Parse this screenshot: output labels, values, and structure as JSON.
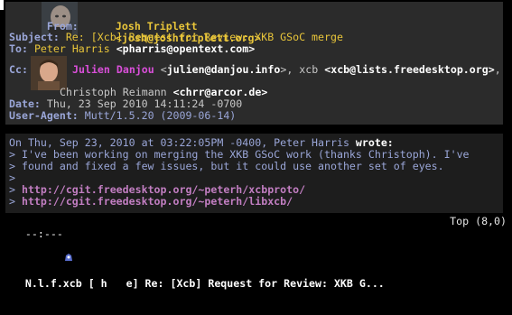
{
  "headers": {
    "from_label": "From:",
    "from_name": "Josh Triplett",
    "from_email": "<josh@joshtriplett.org>",
    "subject_label": "Subject:",
    "subject": "Re: [Xcb] Request for Review: XKB GSoC merge",
    "to_label": "To:",
    "to_name": "Peter Harris",
    "to_email": "<pharris@opentext.com>",
    "cc_label": "Cc:",
    "cc_name1": "Julien Danjou",
    "cc_email1_prefix": "<",
    "cc_email1": "julien@danjou.info",
    "cc_email1_suffix": ">, xcb ",
    "cc_email2": "<xcb@lists.freedesktop.org>",
    "cc_sep": ",",
    "cc_name2": "Christoph Reimann",
    "cc_email3": "<chrr@arcor.de>",
    "date_label": "Date:",
    "date": "Thu, 23 Sep 2010 14:11:24 -0700",
    "ua_label": "User-Agent:",
    "user_agent": "Mutt/1.5.20 (2009-06-14)"
  },
  "body": {
    "attribution": "On Thu, Sep 23, 2010 at 03:22:05PM -0400, Peter Harris",
    "wrote": "wrote:",
    "quote_lines": [
      "> I've been working on merging the XKB GSoC work (thanks Christoph). I've",
      "> found and fixed a few issues, but it could use another set of eyes.",
      ">"
    ],
    "quote_gt": ">",
    "url1": "http://cgit.freedesktop.org/~peterh/xcbproto/",
    "url2": "http://cgit.freedesktop.org/~peterh/libxcb/"
  },
  "status": {
    "mode": "--:---",
    "buffer": "N.l.f.xcb [ h   e] Re: [Xcb] Request for Review: XKB G...",
    "position": "Top (8,0)"
  },
  "colors": {
    "label": "#9aa6d8",
    "from": "#e8c53a",
    "cc_name": "#d94fd9",
    "url": "#c27ec2",
    "header_bg": "#2b2b2b"
  },
  "icons": {
    "avatar1": "avatar-josh-triplett",
    "avatar2": "avatar-julien-danjou",
    "status_icon": "emacs-gnu-icon"
  }
}
